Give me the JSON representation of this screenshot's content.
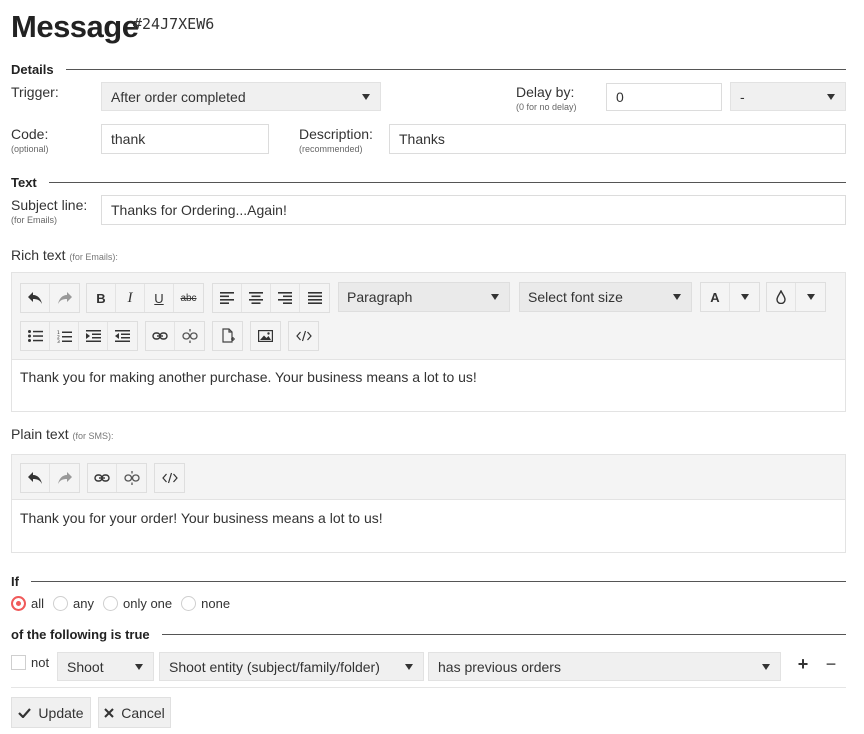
{
  "header": {
    "title": "Message",
    "message_id": "#24J7XEW6"
  },
  "details": {
    "section_label": "Details",
    "trigger_label": "Trigger:",
    "trigger_value": "After order completed",
    "delay_label": "Delay by:",
    "delay_sub": "(0 for no delay)",
    "delay_value": "0",
    "delay_unit_value": "-",
    "code_label": "Code:",
    "code_sub": "(optional)",
    "code_value": "thank",
    "description_label": "Description:",
    "description_sub": "(recommended)",
    "description_value": "Thanks"
  },
  "text": {
    "section_label": "Text",
    "subject_label": "Subject line:",
    "subject_sub": "(for Emails)",
    "subject_value": "Thanks for Ordering...Again!",
    "rich_label": "Rich text",
    "rich_sub": "(for Emails):",
    "rich_block_format": "Paragraph",
    "rich_font_size": "Select font size",
    "rich_font_color_label": "A",
    "rich_content": "Thank you for making another purchase. Your business means a lot to us!",
    "rich_tools": [
      "undo-icon",
      "redo-icon",
      "bold-icon",
      "italic-icon",
      "underline-icon",
      "strikethrough-icon",
      "align-left-icon",
      "align-center-icon",
      "align-right-icon",
      "align-justify-icon",
      "bullet-list-icon",
      "numbered-list-icon",
      "indent-icon",
      "outdent-icon",
      "link-icon",
      "unlink-icon",
      "template-icon",
      "image-icon",
      "code-icon",
      "droplet-icon"
    ],
    "plain_label": "Plain text",
    "plain_sub": "(for SMS):",
    "plain_content": "Thank you for your order! Your business means a lot to us!"
  },
  "toolbar_glyphs": {
    "bold": "B",
    "italic": "I",
    "underline": "U",
    "strike": "abc"
  },
  "conditions": {
    "if_label": "If",
    "options": [
      "all",
      "any",
      "only one",
      "none"
    ],
    "selected": "all",
    "following_label": "of the following is true",
    "not_label": "not",
    "rule_type": "Shoot",
    "rule_entity": "Shoot entity (subject/family/folder)",
    "rule_condition": "has previous orders",
    "add_symbol": "+",
    "remove_symbol": "−"
  },
  "actions": {
    "update_label": "Update",
    "cancel_label": "Cancel"
  },
  "colors": {
    "accent_radio": "#f05a5a",
    "field_bg": "#f0f0f0",
    "toolbar_bg": "#f4f4f4"
  }
}
